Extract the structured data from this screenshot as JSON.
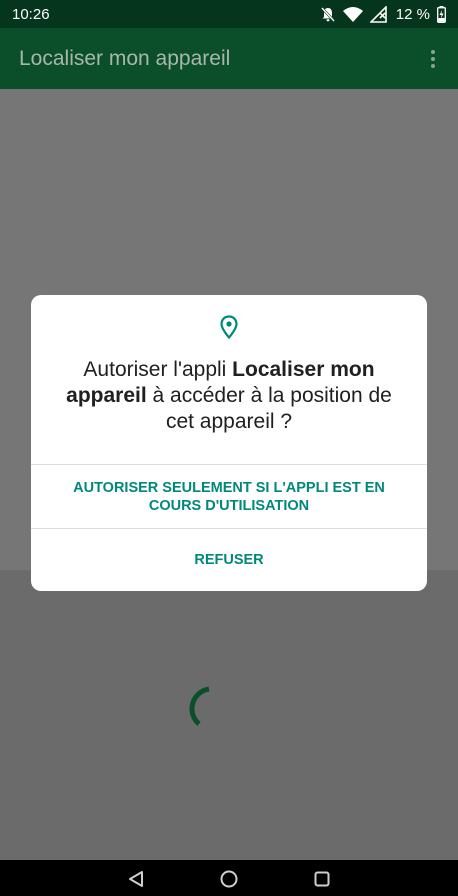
{
  "status_bar": {
    "time": "10:26",
    "battery": "12 %",
    "icons": [
      "notifications-off-icon",
      "wifi-icon",
      "signal-icon",
      "battery-charging-icon"
    ]
  },
  "app_bar": {
    "title": "Localiser mon appareil",
    "menu_icon": "more-vert-icon"
  },
  "dialog": {
    "icon": "location-pin-icon",
    "message_prefix": "Autoriser l'appli ",
    "app_name": "Localiser mon appareil",
    "message_suffix": " à accéder à la position de cet appareil ?",
    "allow_while_using_label": "AUTORISER SEULEMENT SI L'APPLI EST EN COURS D'UTILISATION",
    "deny_label": "REFUSER"
  },
  "colors": {
    "status_bar": "#06351e",
    "app_bar": "#0b4f2a",
    "accent": "#00897b",
    "spinner": "#0b4f2a"
  },
  "nav_bar": {
    "icons": [
      "back-icon",
      "home-icon",
      "recents-icon"
    ]
  }
}
